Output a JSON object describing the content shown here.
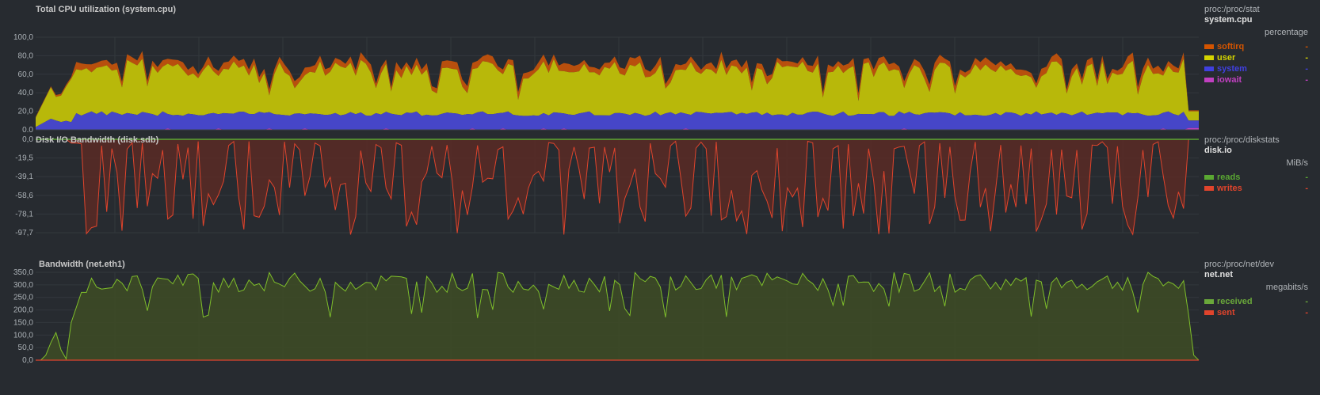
{
  "theme": {
    "background": "#272b30",
    "grid": "#33383d",
    "axis": "#3c4147"
  },
  "charts": [
    {
      "id": "cpu",
      "title": "Total CPU utilization (system.cpu)",
      "context": "proc:/proc/stat",
      "chart_id": "system.cpu",
      "units": "percentage",
      "y_ticks": [
        "100,0",
        "80,0",
        "60,0",
        "40,0",
        "20,0",
        "0,0"
      ],
      "dimensions": [
        {
          "name": "softirq",
          "color": "#d35400",
          "value": "-"
        },
        {
          "name": "user",
          "color": "#d4d400",
          "value": "-"
        },
        {
          "name": "system",
          "color": "#4040e0",
          "value": "-"
        },
        {
          "name": "iowait",
          "color": "#c040c0",
          "value": "-"
        }
      ]
    },
    {
      "id": "disk",
      "title": "Disk I/O Bandwidth (disk.sdb)",
      "context": "proc:/proc/diskstats",
      "chart_id": "disk.io",
      "units": "MiB/s",
      "y_ticks": [
        "0,0",
        "-19,5",
        "-39,1",
        "-58,6",
        "-78,1",
        "-97,7"
      ],
      "dimensions": [
        {
          "name": "reads",
          "color": "#5aa832",
          "value": "-"
        },
        {
          "name": "writes",
          "color": "#e0442c",
          "value": "-"
        }
      ]
    },
    {
      "id": "net",
      "title": "Bandwidth (net.eth1)",
      "context": "proc:/proc/net/dev",
      "chart_id": "net.net",
      "units": "megabits/s",
      "y_ticks": [
        "350,0",
        "300,0",
        "250,0",
        "200,0",
        "150,0",
        "100,0",
        "50,0",
        "0,0"
      ],
      "dimensions": [
        {
          "name": "received",
          "color": "#6aa83a",
          "value": "-"
        },
        {
          "name": "sent",
          "color": "#e0442c",
          "value": "-"
        }
      ]
    }
  ]
}
